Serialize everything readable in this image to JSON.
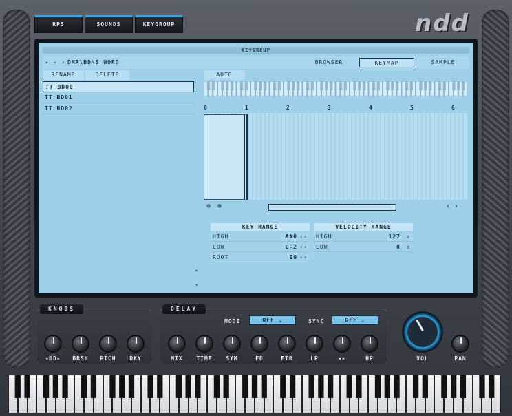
{
  "top_tabs": [
    "RPS",
    "SOUNDS",
    "KEYGROUP"
  ],
  "logo_text": "ndd",
  "screen": {
    "title": "KEYGROUP",
    "path": "DMR\\BD\\S WORD",
    "nav_buttons": [
      "BROWSER",
      "KEYMAP",
      "SAMPLE"
    ],
    "active_nav": "KEYMAP",
    "list_buttons": [
      "RENAME",
      "DELETE"
    ],
    "auto_button": "AUTO",
    "list_items": [
      "TT BD00",
      "TT BD01",
      "TT BD02"
    ],
    "selected_item": "TT BD00",
    "ruler": [
      "0",
      "1",
      "2",
      "3",
      "4",
      "5",
      "6"
    ],
    "key_range": {
      "title": "KEY RANGE",
      "rows": [
        {
          "label": "HIGH",
          "value": "A#0"
        },
        {
          "label": "LOW",
          "value": "C-2"
        },
        {
          "label": "ROOT",
          "value": "E0"
        }
      ]
    },
    "velocity_range": {
      "title": "VELOCITY RANGE",
      "rows": [
        {
          "label": "HIGH",
          "value": "127"
        },
        {
          "label": "LOW",
          "value": "0"
        }
      ]
    }
  },
  "knobs_panel": {
    "title": "KNOBS",
    "knobs": [
      "◂BD▸",
      "BRSH",
      "PTCH",
      "DKY"
    ]
  },
  "delay_panel": {
    "title": "DELAY",
    "mode_label": "MODE",
    "mode_value": "OFF",
    "sync_label": "SYNC",
    "sync_value": "OFF",
    "knobs": [
      "MIX",
      "TIME",
      "SYM",
      "FB",
      "FTR",
      "LP",
      "◂▸",
      "HP"
    ]
  },
  "master": {
    "vol_label": "VOL",
    "pan_label": "PAN"
  },
  "colors": {
    "screen_bg": "#9fd0ea",
    "accent": "#2aa3e6",
    "text_dark": "#173145"
  }
}
